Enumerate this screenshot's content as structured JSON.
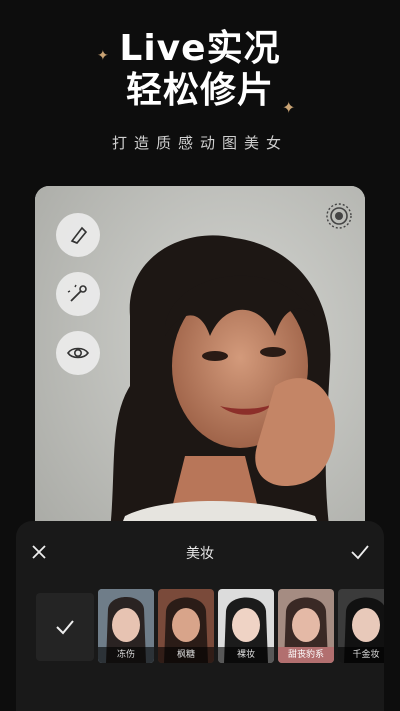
{
  "headline": {
    "line1": "Live实况",
    "line2": "轻松修片"
  },
  "subtitle": "打造质感动图美女",
  "tools": [
    {
      "icon": "eraser-icon"
    },
    {
      "icon": "magic-wand-icon"
    },
    {
      "icon": "eye-icon"
    }
  ],
  "live_icon": "live-photo-icon",
  "panel": {
    "title": "美妆",
    "close_icon": "close-icon",
    "confirm_icon": "check-icon",
    "none_icon": "check-icon",
    "looks": [
      {
        "label": "冻伤"
      },
      {
        "label": "枫糖"
      },
      {
        "label": "裸妆"
      },
      {
        "label": "甜丧豹系",
        "active": true
      },
      {
        "label": "千金妆"
      }
    ]
  },
  "colors": {
    "accent": "#c9a374",
    "panel": "#191919",
    "active_label": "#b26f6f"
  }
}
